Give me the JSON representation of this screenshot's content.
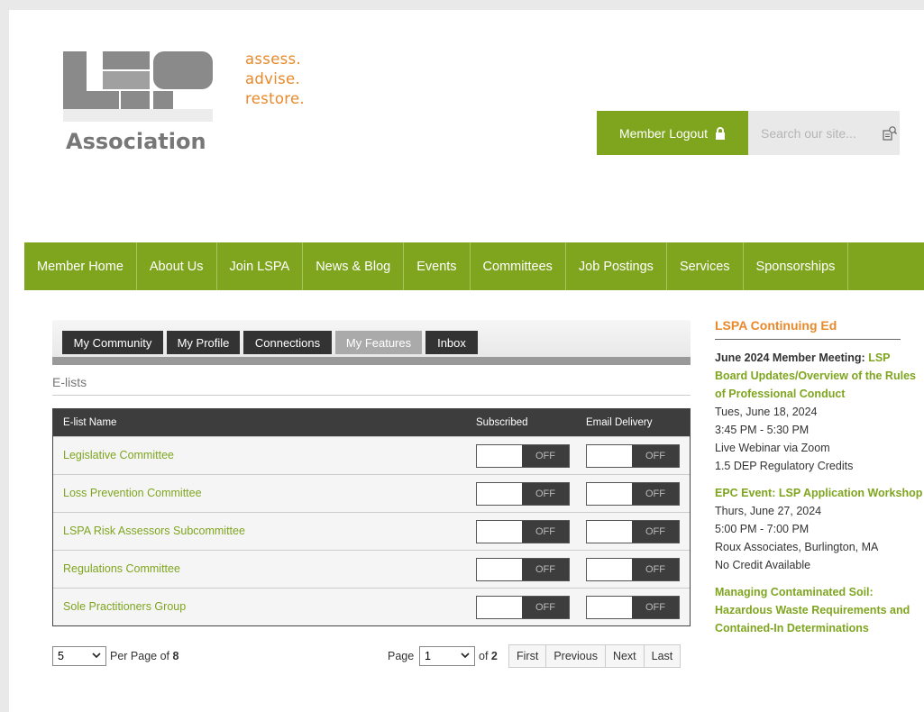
{
  "header": {
    "logo_text": "Association",
    "tagline": [
      "assess.",
      "advise.",
      "restore."
    ],
    "logout_label": "Member Logout",
    "search_placeholder": "Search our site..."
  },
  "nav": [
    "Member Home",
    "About Us",
    "Join LSPA",
    "News & Blog",
    "Events",
    "Committees",
    "Job Postings",
    "Services",
    "Sponsorships"
  ],
  "tabs": [
    "My Community",
    "My Profile",
    "Connections",
    "My Features",
    "Inbox"
  ],
  "active_tab": "My Features",
  "section_title": "E-lists",
  "table": {
    "headers": [
      "E-list Name",
      "Subscribed",
      "Email Delivery"
    ],
    "rows": [
      {
        "name": "Legislative Committee",
        "subscribed": "OFF",
        "delivery": "OFF"
      },
      {
        "name": "Loss Prevention Committee",
        "subscribed": "OFF",
        "delivery": "OFF"
      },
      {
        "name": "LSPA Risk Assessors Subcommittee",
        "subscribed": "OFF",
        "delivery": "OFF"
      },
      {
        "name": "Regulations Committee",
        "subscribed": "OFF",
        "delivery": "OFF"
      },
      {
        "name": "Sole Practitioners Group",
        "subscribed": "OFF",
        "delivery": "OFF"
      }
    ]
  },
  "pager": {
    "per_page_value": "5",
    "per_page_label": "Per Page of",
    "total": "8",
    "page_label": "Page",
    "page_value": "1",
    "of_label": "of",
    "page_count": "2",
    "buttons": [
      "First",
      "Previous",
      "Next",
      "Last"
    ]
  },
  "sidebar": {
    "title": "LSPA Continuing Ed",
    "events": [
      {
        "prefix": "June 2024 Member Meeting:",
        "title": "LSP Board Updates/Overview of the Rules of Professional Conduct",
        "lines": [
          "Tues, June 18, 2024",
          "3:45 PM - 5:30 PM",
          "Live Webinar via Zoom",
          "1.5 DEP Regulatory Credits"
        ]
      },
      {
        "prefix": "",
        "title": "EPC Event: LSP Application Workshop",
        "lines": [
          "Thurs, June 27, 2024",
          "5:00 PM - 7:00 PM",
          "Roux Associates, Burlington, MA",
          "No Credit Available"
        ]
      },
      {
        "prefix": "",
        "title": "Managing Contaminated Soil: Hazardous Waste Requirements and Contained-In Determinations",
        "lines": []
      }
    ]
  },
  "colors": {
    "brand_green": "#7fa51f",
    "brand_orange": "#e8892b",
    "dark": "#3d3d3d"
  }
}
